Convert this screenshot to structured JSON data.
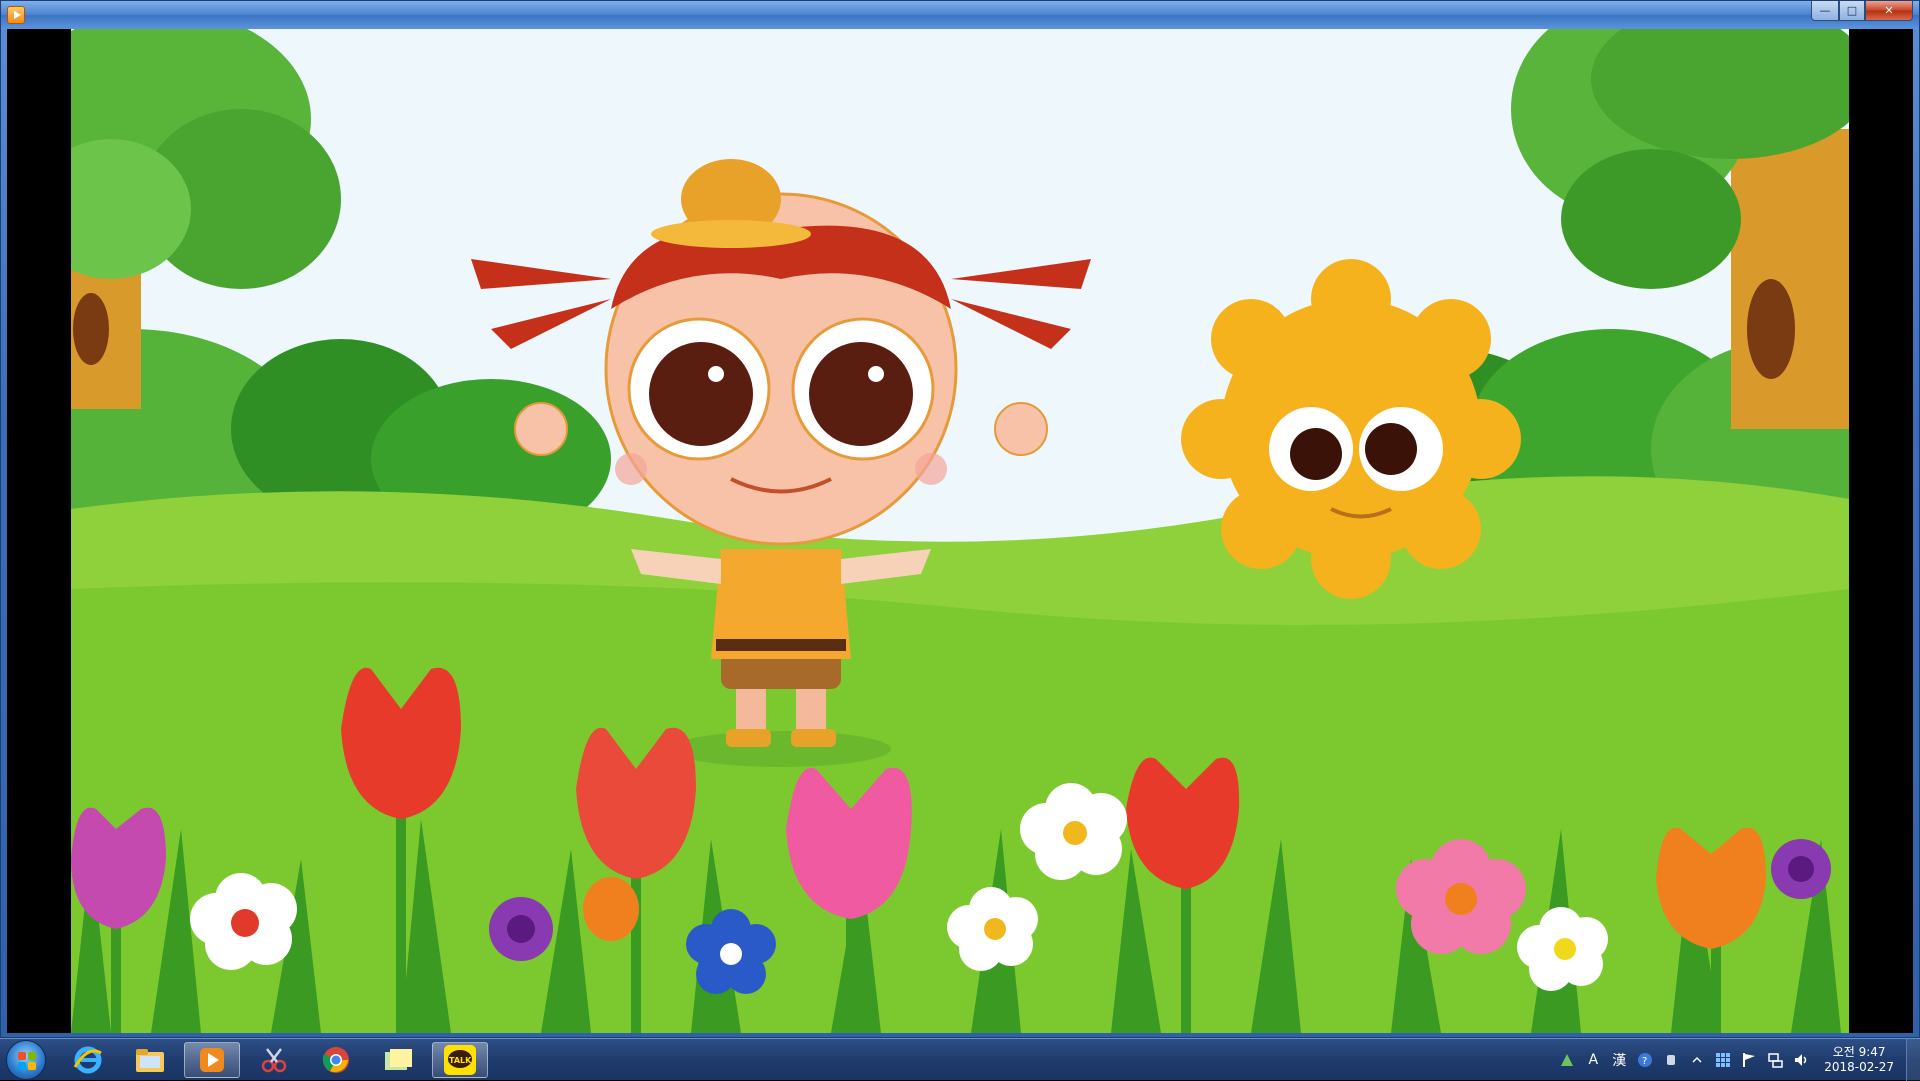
{
  "window": {
    "title": "",
    "controls": {
      "minimize": "—",
      "maximize": "□",
      "close": "✕"
    }
  },
  "scene": {
    "description_icons": [
      "tree",
      "girl-character",
      "sun-character",
      "tulip",
      "daisy"
    ],
    "colors": {
      "sky": "#eef7fb",
      "grass": "#7ccc2e",
      "bush": "#3da02a",
      "sun": "#f6b21c",
      "hair": "#c5301a"
    }
  },
  "taskbar": {
    "pinned": [
      {
        "name": "internet-explorer",
        "active": false
      },
      {
        "name": "file-explorer",
        "active": false
      },
      {
        "name": "media-player",
        "active": true
      },
      {
        "name": "snipping-tool",
        "active": false
      },
      {
        "name": "chrome",
        "active": false
      },
      {
        "name": "sticky-notes",
        "active": false
      },
      {
        "name": "kakaotalk",
        "active": true
      }
    ],
    "kakao_label": "TALK",
    "ime": {
      "a": "A",
      "han": "漢"
    },
    "clock": {
      "time": "오전 9:47",
      "date": "2018-02-27"
    }
  }
}
